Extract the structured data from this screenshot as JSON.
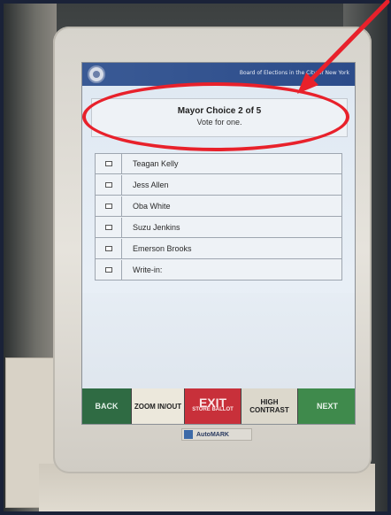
{
  "banner": {
    "org_text": "Board of Elections in the City of New York"
  },
  "contest": {
    "title": "Mayor Choice 2 of 5",
    "instruction": "Vote for one."
  },
  "candidates": [
    {
      "name": "Teagan Kelly"
    },
    {
      "name": "Jess Allen"
    },
    {
      "name": "Oba White"
    },
    {
      "name": "Suzu Jenkins"
    },
    {
      "name": "Emerson Brooks"
    },
    {
      "name": "Write-in:"
    }
  ],
  "buttons": {
    "back": "BACK",
    "zoom": "ZOOM IN/OUT",
    "exit": "EXIT",
    "exit_sub": "STORE BALLOT",
    "contrast": "HIGH CONTRAST",
    "next": "NEXT"
  },
  "device": {
    "logo": "AutoMARK"
  },
  "colors": {
    "annotation": "#e8212b",
    "banner": "#2c4c8a",
    "back_button": "#2f6b43",
    "exit_button": "#c8303a",
    "next_button": "#3f8a4c"
  }
}
